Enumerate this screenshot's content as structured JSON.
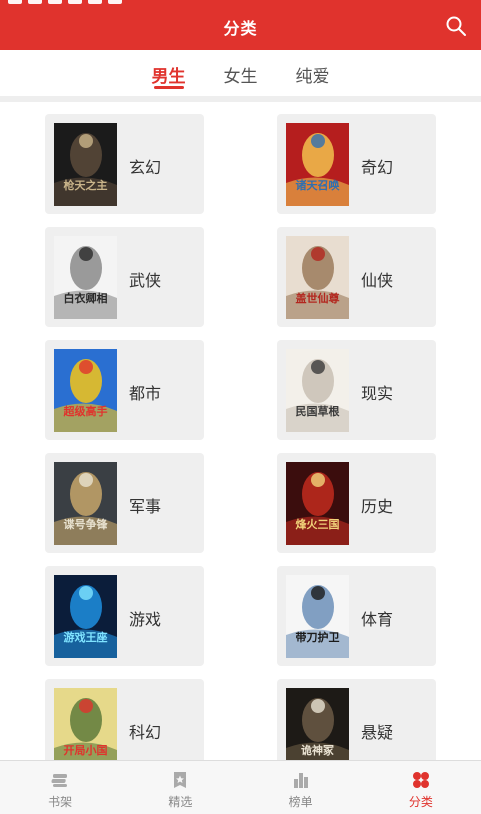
{
  "header": {
    "title": "分类",
    "bg_color": "#e0332d",
    "search_icon": "search-icon"
  },
  "tabs": [
    {
      "label": "男生",
      "active": true
    },
    {
      "label": "女生",
      "active": false
    },
    {
      "label": "纯爱",
      "active": false
    }
  ],
  "categories": [
    {
      "label": "玄幻",
      "cover_palette": [
        "#1b1b1b",
        "#5a4a3a",
        "#c9b48a"
      ],
      "cover_title": "枪天之主"
    },
    {
      "label": "奇幻",
      "cover_palette": [
        "#b51e1e",
        "#f2c14e",
        "#2f6fb1"
      ],
      "cover_title": "诸天召唤"
    },
    {
      "label": "武侠",
      "cover_palette": [
        "#f4f4f4",
        "#8a8a8a",
        "#2a2a2a"
      ],
      "cover_title": "白衣卿相"
    },
    {
      "label": "仙侠",
      "cover_palette": [
        "#e8ddd0",
        "#9b7b5c",
        "#b3261e"
      ],
      "cover_title": "盖世仙尊"
    },
    {
      "label": "都市",
      "cover_palette": [
        "#2a6fd1",
        "#f5c518",
        "#e0332d"
      ],
      "cover_title": "超级高手"
    },
    {
      "label": "现实",
      "cover_palette": [
        "#f3f0ea",
        "#c8c0b4",
        "#3a3a3a"
      ],
      "cover_title": "民国草根"
    },
    {
      "label": "军事",
      "cover_palette": [
        "#3a3f44",
        "#c7a66a",
        "#e8e2d0"
      ],
      "cover_title": "谍号争锋"
    },
    {
      "label": "历史",
      "cover_palette": [
        "#3b0d0d",
        "#c22b1f",
        "#f1d37a"
      ],
      "cover_title": "烽火三国"
    },
    {
      "label": "游戏",
      "cover_palette": [
        "#0b1d3a",
        "#1f8fe0",
        "#7fe3ff"
      ],
      "cover_title": "游戏王座"
    },
    {
      "label": "体育",
      "cover_palette": [
        "#f6f6f6",
        "#6c8fb8",
        "#1a1a1a"
      ],
      "cover_title": "带刀护卫"
    },
    {
      "label": "科幻",
      "cover_palette": [
        "#e6d98a",
        "#5e7a3a",
        "#e0332d"
      ],
      "cover_title": "开局小国"
    },
    {
      "label": "悬疑",
      "cover_palette": [
        "#1d1a16",
        "#6b5b45",
        "#e9e2d2"
      ],
      "cover_title": "诡神冢"
    }
  ],
  "bottom_nav": [
    {
      "label": "书架",
      "icon": "bookshelf-icon",
      "active": false
    },
    {
      "label": "精选",
      "icon": "featured-star-icon",
      "active": false
    },
    {
      "label": "榜单",
      "icon": "ranking-bars-icon",
      "active": false
    },
    {
      "label": "分类",
      "icon": "category-grid-icon",
      "active": true
    }
  ],
  "colors": {
    "accent": "#e0332d",
    "card_bg": "#efefef",
    "nav_inactive": "#888888"
  }
}
